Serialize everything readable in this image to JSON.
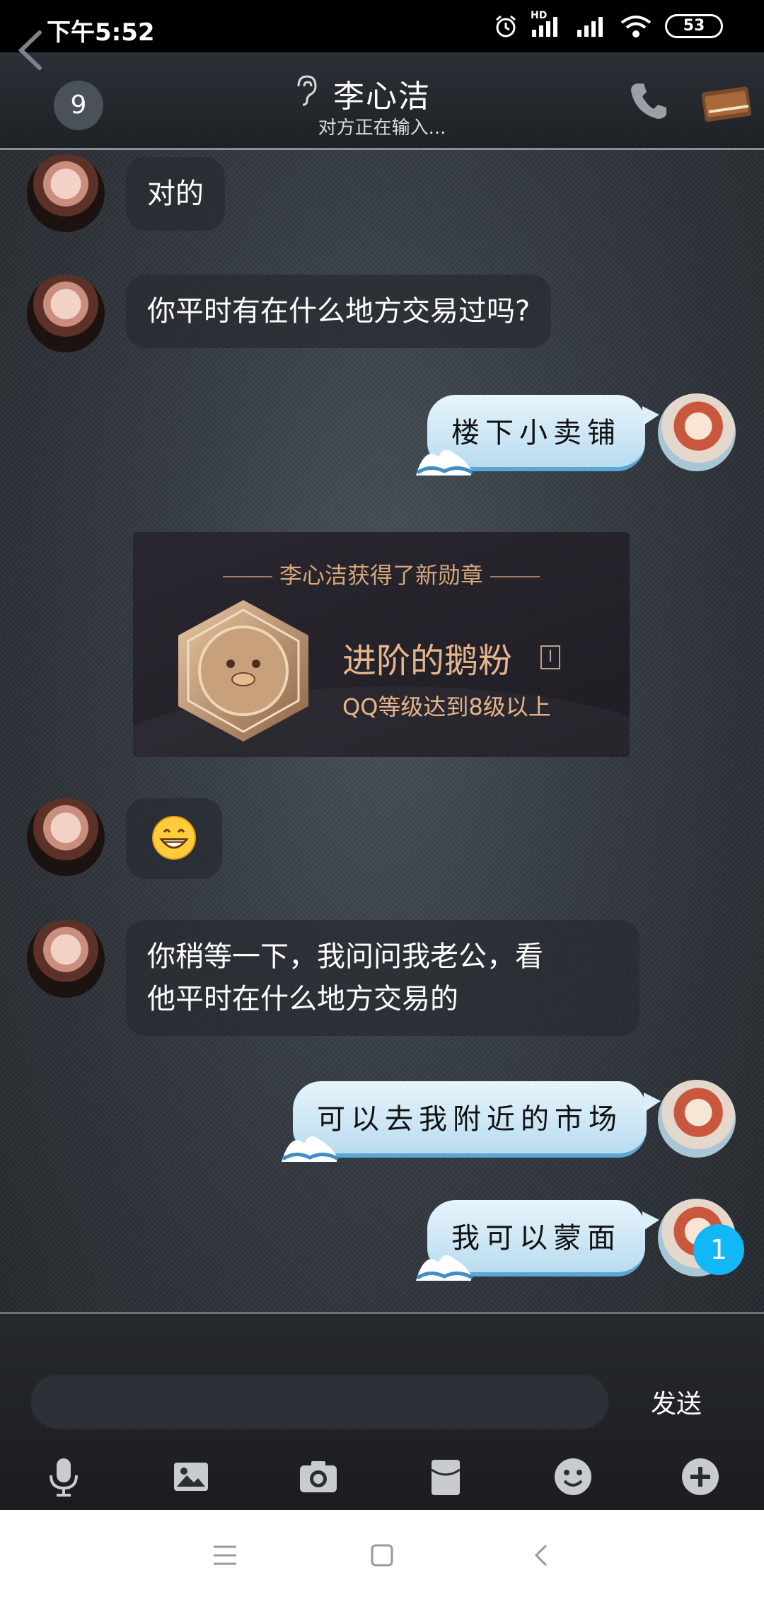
{
  "status_bar": {
    "time": "下午5:52",
    "hd_label": "HD",
    "battery": "53"
  },
  "header": {
    "back_label": "<",
    "unread_count": "9",
    "contact_name": "李心洁",
    "typing_status": "对方正在输入..."
  },
  "messages": [
    {
      "side": "in",
      "text": "对的"
    },
    {
      "side": "in",
      "text": "你平时有在什么地方交易过吗?"
    },
    {
      "side": "out",
      "text": "楼下小卖铺"
    },
    {
      "side": "system_medal",
      "caption": "李心洁获得了新勋章",
      "title": "进阶的鹅粉",
      "info": "I",
      "desc": "QQ等级达到8级以上"
    },
    {
      "side": "in",
      "emoji": "grin-emoji"
    },
    {
      "side": "in",
      "text_line1": "你稍等一下，我问问我老公，看",
      "text_line2": "他平时在什么地方交易的"
    },
    {
      "side": "out",
      "text": "可以去我附近的市场"
    },
    {
      "side": "out",
      "text": "我可以蒙面"
    }
  ],
  "new_message_badge": "1",
  "input": {
    "placeholder": "",
    "send_label": "发送"
  },
  "toolbar_icons": [
    "microphone-icon",
    "image-icon",
    "camera-icon",
    "red-packet-icon",
    "emoji-icon",
    "plus-icon"
  ],
  "colors": {
    "out_bubble": "#cde8f6",
    "badge": "#12b7f5",
    "medal_gold": "#e6b58b"
  }
}
